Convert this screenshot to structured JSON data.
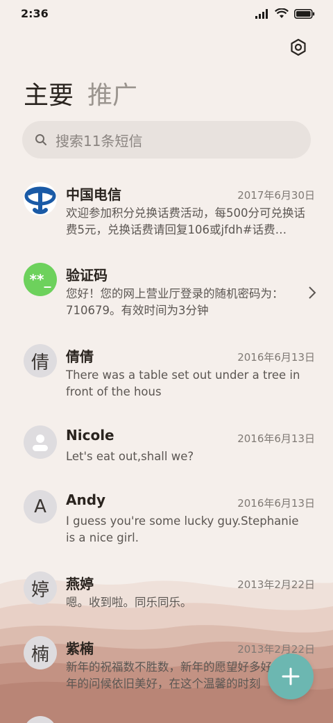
{
  "status": {
    "time": "2:36"
  },
  "tabs": [
    {
      "label": "主要"
    },
    {
      "label": "推广"
    }
  ],
  "search": {
    "placeholder": "搜索11条短信"
  },
  "conversations": [
    {
      "name": "中国电信",
      "date": "2017年6月30日",
      "preview": "欢迎参加积分兑换话费活动，每500分可兑换话费5元，兑换话费请回复106或jfdh#话费…",
      "avatar": "telecom-logo"
    },
    {
      "name": "验证码",
      "date": "",
      "preview": "您好！您的网上营业厅登录的随机密码为：710679。有效时间为3分钟",
      "avatar_text": "**_"
    },
    {
      "name": "倩倩",
      "date": "2016年6月13日",
      "preview": "There was a table set out under a tree in front of the hous",
      "avatar_text": "倩"
    },
    {
      "name": "Nicole",
      "date": "2016年6月13日",
      "preview": "Let's eat out,shall we?",
      "avatar": "person-icon"
    },
    {
      "name": "Andy",
      "date": "2016年6月13日",
      "preview": "I guess you're some lucky guy.Stephanie is a nice girl.",
      "avatar_text": "A"
    },
    {
      "name": "燕婷",
      "date": "2013年2月22日",
      "preview": "嗯。收到啦。同乐同乐。",
      "avatar_text": "婷"
    },
    {
      "name": "紫楠",
      "date": "2013年2月22日",
      "preview": "新年的祝福数不胜数，新年的愿望好多好多，新年的问候依旧美好，在这个温馨的时刻",
      "avatar_text": "楠"
    }
  ],
  "colors": {
    "accent": "#6cb7b1",
    "verify": "#6dd15c",
    "telecom": "#1a5aa6"
  }
}
